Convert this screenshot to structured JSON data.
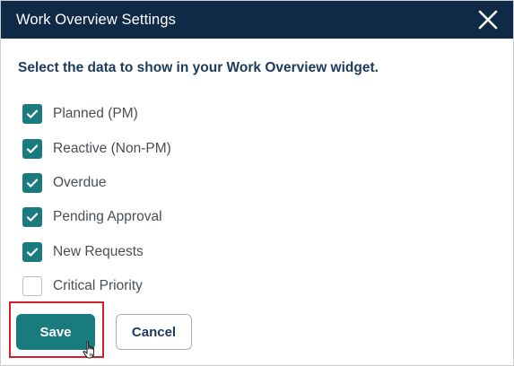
{
  "dialog": {
    "title": "Work Overview Settings",
    "instructions": "Select the data to show in your Work Overview widget."
  },
  "options": [
    {
      "label": "Planned (PM)",
      "checked": true
    },
    {
      "label": "Reactive (Non-PM)",
      "checked": true
    },
    {
      "label": "Overdue",
      "checked": true
    },
    {
      "label": "Pending Approval",
      "checked": true
    },
    {
      "label": "New Requests",
      "checked": true
    },
    {
      "label": "Critical Priority",
      "checked": false
    }
  ],
  "buttons": {
    "save_label": "Save",
    "cancel_label": "Cancel"
  },
  "icons": {
    "close": "close-icon",
    "check": "checkmark-icon",
    "cursor": "hand-pointer-icon"
  },
  "colors": {
    "header_bg": "#0f2a47",
    "accent_teal": "#1a7b7e",
    "highlight_red": "#d61f2b",
    "heading_text": "#1c3a5c"
  }
}
